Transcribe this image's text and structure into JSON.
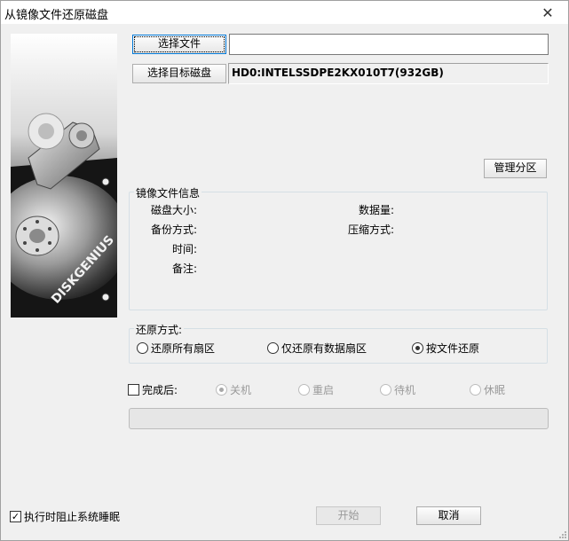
{
  "window": {
    "title": "从镜像文件还原磁盘",
    "close_glyph": "✕"
  },
  "hero": {
    "brand": "DISKGENIUS"
  },
  "source": {
    "button_label": "选择文件",
    "path_value": ""
  },
  "target": {
    "button_label": "选择目标磁盘",
    "disk_value": "HD0:INTELSSDPE2KX010T7(932GB)"
  },
  "manage_partitions_label": "管理分区",
  "image_info": {
    "title": "镜像文件信息",
    "disk_size_label": "磁盘大小:",
    "data_amount_label": "数据量:",
    "backup_mode_label": "备份方式:",
    "compression_label": "压缩方式:",
    "time_label": "时间:",
    "notes_label": "备注:"
  },
  "restore_mode": {
    "title": "还原方式:",
    "options": [
      "还原所有扇区",
      "仅还原有数据扇区",
      "按文件还原"
    ],
    "selected": "按文件还原"
  },
  "after_completion": {
    "label": "完成后:",
    "checked": false,
    "options": [
      "关机",
      "重启",
      "待机",
      "休眠"
    ],
    "selected": "关机",
    "enabled": false
  },
  "progress": {
    "fraction": 0
  },
  "prevent_sleep": {
    "label": "执行时阻止系统睡眠",
    "checked": true
  },
  "footer": {
    "start_label": "开始",
    "cancel_label": "取消"
  },
  "colors": {
    "focus_border": "#0078d7",
    "window_bg": "#f0f0f0",
    "frame_line": "#d5dfe5"
  }
}
